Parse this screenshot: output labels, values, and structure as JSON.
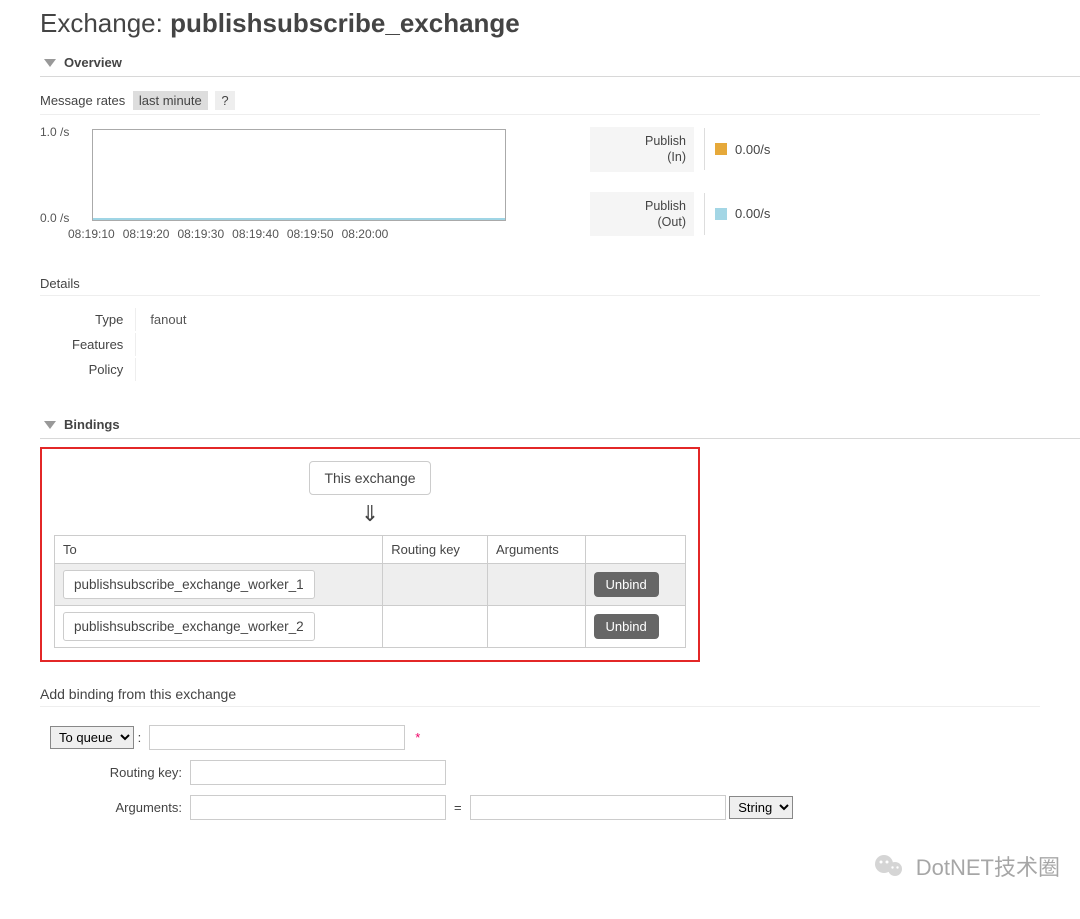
{
  "title_prefix": "Exchange: ",
  "title_name": "publishsubscribe_exchange",
  "overview": {
    "label": "Overview",
    "message_rates_label": "Message rates",
    "time_range": "last minute",
    "help": "?"
  },
  "chart_data": {
    "type": "line",
    "ylim": [
      0.0,
      1.0
    ],
    "y_ticks": [
      "1.0 /s",
      "0.0 /s"
    ],
    "x_ticks": [
      "08:19:10",
      "08:19:20",
      "08:19:30",
      "08:19:40",
      "08:19:50",
      "08:20:00"
    ],
    "series": [
      {
        "name": "Publish (In)",
        "rate": "0.00/s",
        "color": "#e6a93a"
      },
      {
        "name": "Publish (Out)",
        "rate": "0.00/s",
        "color": "#a3d6e5"
      }
    ]
  },
  "legend": {
    "pub_in_l1": "Publish",
    "pub_in_l2": "(In)",
    "pub_out_l1": "Publish",
    "pub_out_l2": "(Out)"
  },
  "details": {
    "heading": "Details",
    "rows": {
      "type_label": "Type",
      "type_value": "fanout",
      "features_label": "Features",
      "features_value": "",
      "policy_label": "Policy",
      "policy_value": ""
    }
  },
  "bindings": {
    "label": "Bindings",
    "this_exchange": "This exchange",
    "arrow": "⇓",
    "cols": {
      "to": "To",
      "routing_key": "Routing key",
      "arguments": "Arguments"
    },
    "rows": [
      {
        "to": "publishsubscribe_exchange_worker_1",
        "routing_key": "",
        "arguments": "",
        "unbind": "Unbind"
      },
      {
        "to": "publishsubscribe_exchange_worker_2",
        "routing_key": "",
        "arguments": "",
        "unbind": "Unbind"
      }
    ]
  },
  "add_binding": {
    "heading": "Add binding from this exchange",
    "destination_select": "To queue",
    "destination_value": "",
    "routing_key_label": "Routing key:",
    "routing_key_value": "",
    "arguments_label": "Arguments:",
    "arg_key": "",
    "arg_val": "",
    "arg_type": "String",
    "required": "*",
    "colon": ":",
    "equals": "="
  },
  "watermark": "DotNET技术圈"
}
